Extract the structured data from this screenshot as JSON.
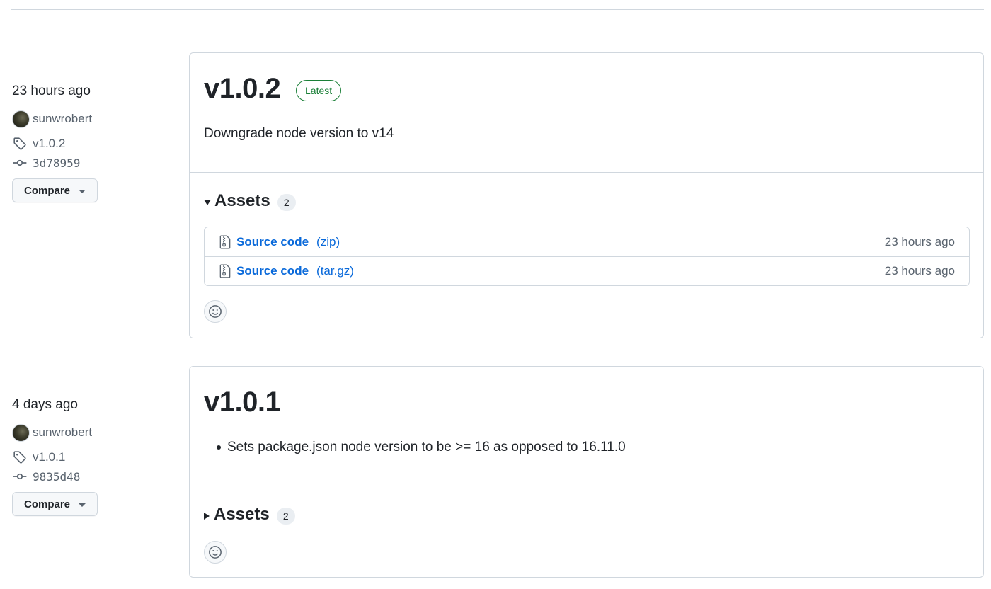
{
  "releases": [
    {
      "date": "23 hours ago",
      "author": "sunwrobert",
      "tag": "v1.0.2",
      "commit": "3d78959",
      "compare_label": "Compare",
      "title": "v1.0.2",
      "badge": "Latest",
      "notes": "Downgrade node version to v14",
      "assets_label": "Assets",
      "assets_count": "2",
      "assets_expanded": true,
      "assets": [
        {
          "name": "Source code",
          "ext": "(zip)",
          "time": "23 hours ago"
        },
        {
          "name": "Source code",
          "ext": "(tar.gz)",
          "time": "23 hours ago"
        }
      ]
    },
    {
      "date": "4 days ago",
      "author": "sunwrobert",
      "tag": "v1.0.1",
      "commit": "9835d48",
      "compare_label": "Compare",
      "title": "v1.0.1",
      "notes_bullets": [
        "Sets package.json node version to be >= 16 as opposed to 16.11.0"
      ],
      "assets_label": "Assets",
      "assets_count": "2",
      "assets_expanded": false
    }
  ],
  "icons": {
    "tag": "tag-icon",
    "commit": "git-commit-icon",
    "zip": "file-zip-icon",
    "reaction": "smiley-icon"
  },
  "colors": {
    "link": "#0969da",
    "latest_badge": "#1a7f37",
    "muted_text": "#59636e",
    "border": "#d0d7de"
  }
}
